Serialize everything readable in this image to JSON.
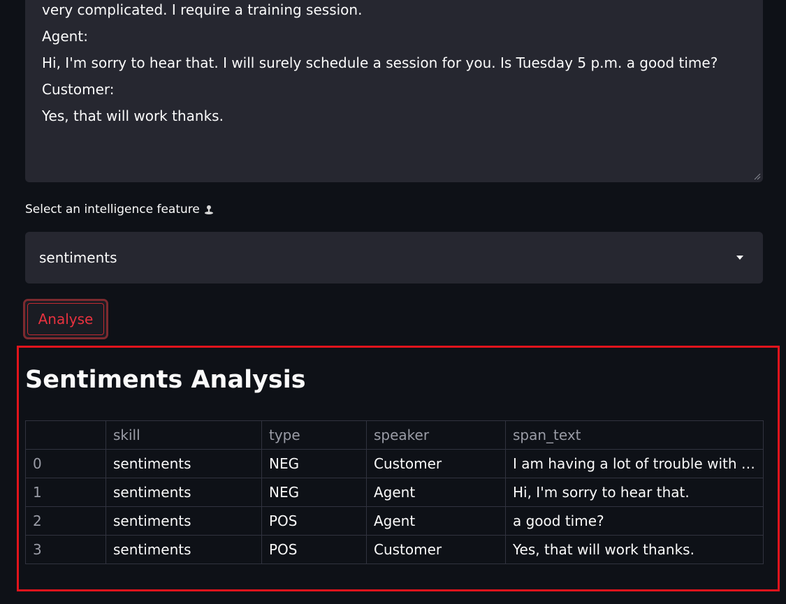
{
  "transcript": {
    "lines": [
      "very complicated. I require a training session.",
      "Agent:",
      "Hi, I'm sorry to hear that. I will surely schedule a session for you. Is Tuesday 5 p.m. a good time?",
      "Customer:",
      "Yes, that will work thanks."
    ]
  },
  "feature_select": {
    "label": "Select an intelligence feature",
    "value": "sentiments"
  },
  "analyse_button": {
    "label": "Analyse"
  },
  "result": {
    "title": "Sentiments Analysis",
    "columns": [
      "",
      "skill",
      "type",
      "speaker",
      "span_text"
    ],
    "rows": [
      [
        "0",
        "sentiments",
        "NEG",
        "Customer",
        "I am having a lot of trouble with the new software"
      ],
      [
        "1",
        "sentiments",
        "NEG",
        "Agent",
        "Hi, I'm sorry to hear that."
      ],
      [
        "2",
        "sentiments",
        "POS",
        "Agent",
        "a good time?"
      ],
      [
        "3",
        "sentiments",
        "POS",
        "Customer",
        "Yes, that will work thanks."
      ]
    ]
  },
  "colors": {
    "background": "#0e1117",
    "input_bg": "#262730",
    "accent_red": "#e8323f",
    "highlight": "#e0141c"
  }
}
